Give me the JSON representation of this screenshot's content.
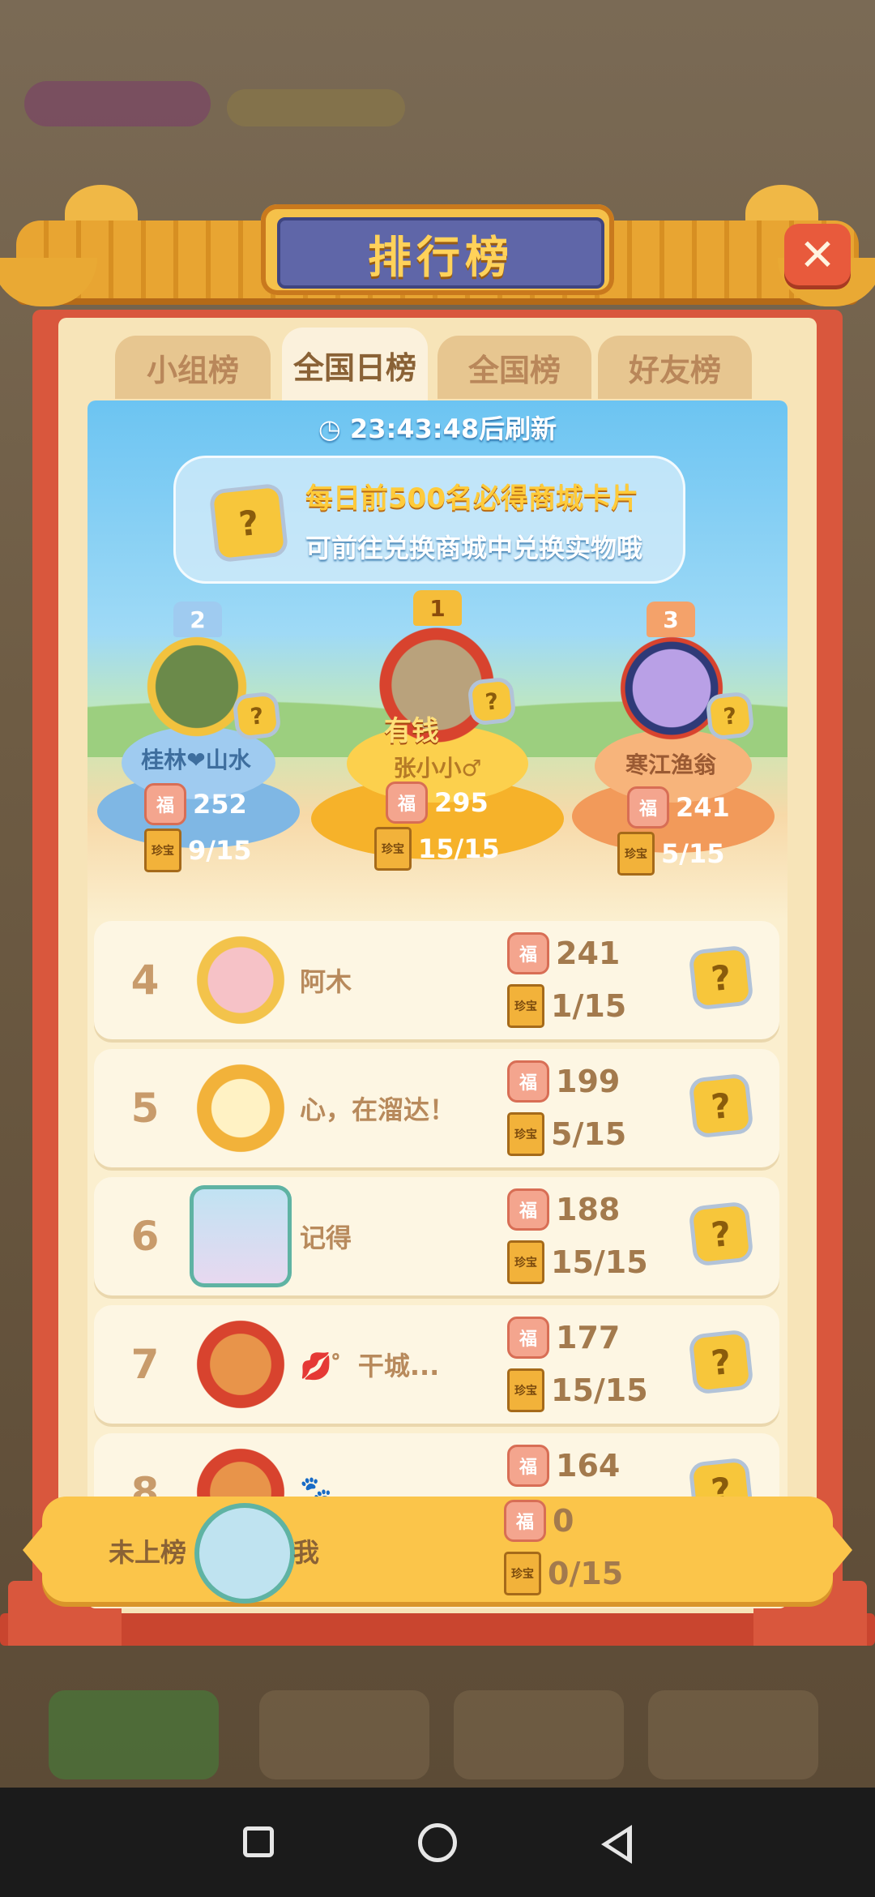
{
  "title": "排行榜",
  "tabs": [
    {
      "label": "小组榜",
      "active": false
    },
    {
      "label": "全国日榜",
      "active": true
    },
    {
      "label": "全国榜",
      "active": false
    },
    {
      "label": "好友榜",
      "active": false
    }
  ],
  "banner": {
    "refresh_time": "23:43:48",
    "refresh_suffix": "后刷新",
    "notice_line1": "每日前500名必得商城卡片",
    "notice_line2": "可前往兑换商城中兑换实物哦"
  },
  "podium": [
    {
      "rank": "2",
      "name": "桂林❤山水",
      "fu": "252",
      "progress": "9/15"
    },
    {
      "rank": "1",
      "name": "张小小♂",
      "fu": "295",
      "progress": "15/15",
      "badge": "有钱"
    },
    {
      "rank": "3",
      "name": "寒江渔翁",
      "fu": "241",
      "progress": "5/15"
    }
  ],
  "rows": [
    {
      "rank": "4",
      "name": "阿木",
      "fu": "241",
      "progress": "1/15"
    },
    {
      "rank": "5",
      "name": "心，在溜达！",
      "fu": "199",
      "progress": "5/15"
    },
    {
      "rank": "6",
      "name": "记得",
      "fu": "188",
      "progress": "15/15"
    },
    {
      "rank": "7",
      "name": "💋゜干城...",
      "fu": "177",
      "progress": "15/15"
    },
    {
      "rank": "8",
      "name": "🐾",
      "fu": "164",
      "progress": ""
    }
  ],
  "me": {
    "status": "未上榜",
    "name": "我",
    "fu": "0",
    "progress": "0/15"
  },
  "icons": {
    "fu": "福",
    "book": "珍宝",
    "puzzle": "?",
    "close": "✕"
  },
  "colors": {
    "frame": "#d9573d",
    "roof": "#e8a532",
    "plaque": "#5f66a8",
    "gold": "#fbc54a",
    "row_bg": "#fdf6e3"
  }
}
